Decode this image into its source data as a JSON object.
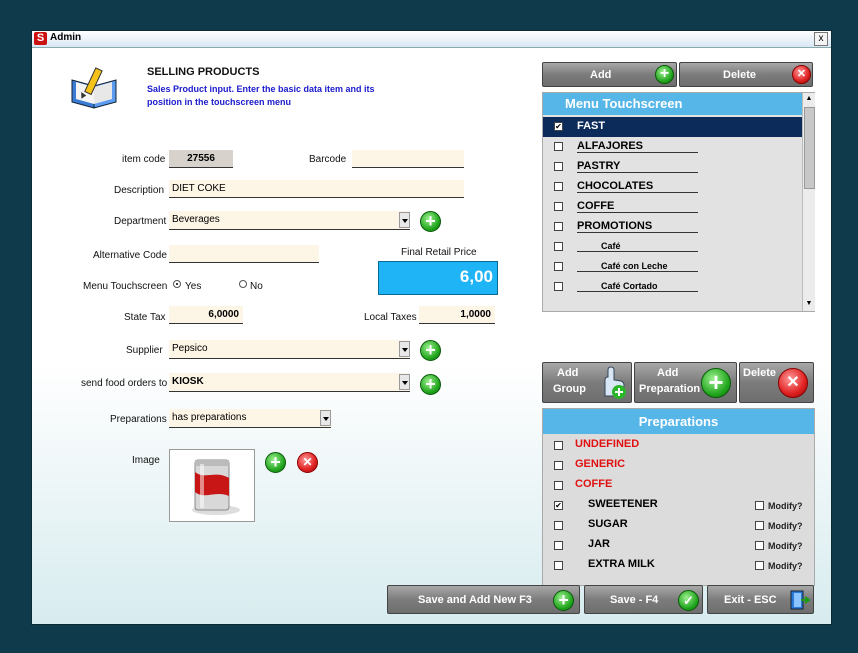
{
  "window": {
    "title": "Admin",
    "close": "x"
  },
  "header": {
    "title": "SELLING PRODUCTS",
    "subtitle_line1": "Sales Product input. Enter the basic data item and its",
    "subtitle_line2": "position in the touchscreen menu"
  },
  "form": {
    "item_code_label": "item code",
    "item_code_value": "27556",
    "barcode_label": "Barcode",
    "barcode_value": "",
    "description_label": "Description",
    "description_value": "DIET COKE",
    "department_label": "Department",
    "department_value": "Beverages",
    "alt_code_label": "Alternative Code",
    "alt_code_value": "",
    "final_price_label": "Final Retail Price",
    "final_price_value": "6,00",
    "menu_touch_label": "Menu Touchscreen",
    "yes_label": "Yes",
    "no_label": "No",
    "state_tax_label": "State Tax",
    "state_tax_value": "6,0000",
    "local_tax_label": "Local Taxes",
    "local_tax_value": "1,0000",
    "supplier_label": "Supplier",
    "supplier_value": "Pepsico",
    "send_food_label": "send food orders to",
    "send_food_value": "KIOSK",
    "preparations_label": "Preparations",
    "preparations_value": "has preparations",
    "image_label": "Image"
  },
  "menu_panel": {
    "add_label": "Add",
    "delete_label": "Delete",
    "title": "Menu Touchscreen",
    "items": [
      {
        "label": "FAST",
        "checked": true
      },
      {
        "label": "ALFAJORES",
        "checked": false
      },
      {
        "label": "PASTRY",
        "checked": false
      },
      {
        "label": "CHOCOLATES",
        "checked": false
      },
      {
        "label": "COFFE",
        "checked": false
      },
      {
        "label": "PROMOTIONS",
        "checked": false
      },
      {
        "label": "Café",
        "checked": false
      },
      {
        "label": "Café con Leche",
        "checked": false
      },
      {
        "label": "Café Cortado",
        "checked": false
      }
    ]
  },
  "prep_panel": {
    "add_group_line1": "Add",
    "add_group_line2": "Group",
    "add_prep_line1": "Add",
    "add_prep_line2": "Preparation",
    "delete_label": "Delete",
    "title": "Preparations",
    "groups": [
      "UNDEFINED",
      "GENERIC",
      "COFFE"
    ],
    "items": [
      {
        "label": "SWEETENER",
        "checked": true,
        "modify": "Modify?"
      },
      {
        "label": "SUGAR",
        "checked": false,
        "modify": "Modify?"
      },
      {
        "label": "JAR",
        "checked": false,
        "modify": "Modify?"
      },
      {
        "label": "EXTRA MILK",
        "checked": false,
        "modify": "Modify?"
      }
    ],
    "group_color": "#e01010"
  },
  "footer": {
    "save_add_label": "Save and Add New F3",
    "save_label": "Save - F4",
    "exit_label": "Exit - ESC"
  },
  "icons": {
    "app": "app-logo-icon",
    "book": "book-pencil-icon",
    "plus": "plus-icon",
    "x": "delete-x-icon",
    "check": "check-icon",
    "exit": "exit-door-icon",
    "hand": "hand-pointer-icon"
  },
  "colors": {
    "accent": "#57b6e8",
    "price_bg": "#1fb4f5",
    "field_bg": "#fdf5e6"
  }
}
